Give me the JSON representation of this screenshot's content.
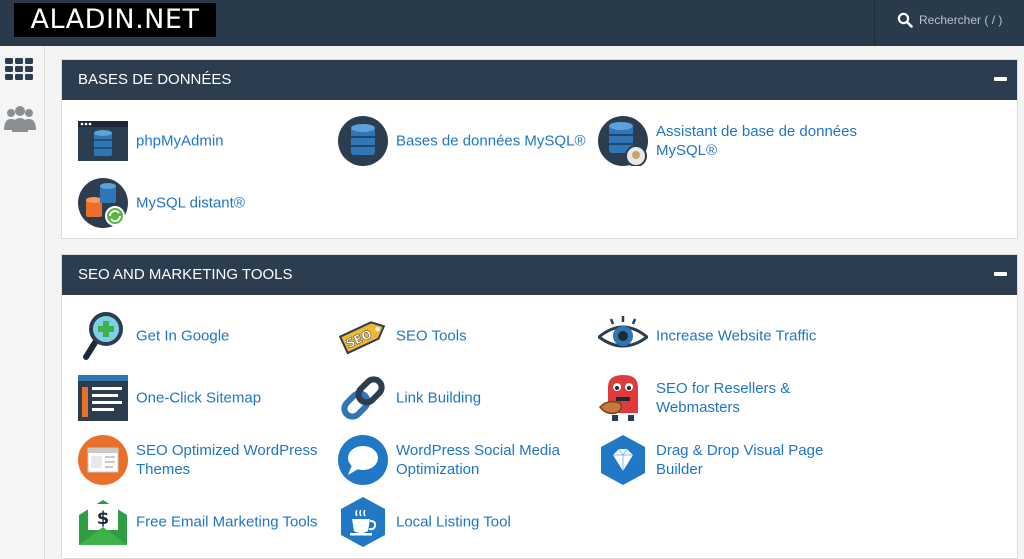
{
  "header": {
    "logo_text": "ALADIN.NET",
    "search_placeholder": "Rechercher ( / )"
  },
  "sidebar": {
    "items": [
      {
        "icon": "grid-icon"
      },
      {
        "icon": "users-icon"
      }
    ]
  },
  "sections": [
    {
      "title": "BASES DE DONNÉES",
      "collapse_symbol": "minus-icon",
      "items": [
        {
          "label": "phpMyAdmin",
          "icon": "phpmyadmin-icon"
        },
        {
          "label": "Bases de données MySQL®",
          "icon": "mysql-databases-icon"
        },
        {
          "label": "Assistant de base de données MySQL®",
          "icon": "mysql-wizard-icon"
        },
        {
          "label": "MySQL distant®",
          "icon": "remote-mysql-icon"
        }
      ]
    },
    {
      "title": "SEO AND MARKETING TOOLS",
      "collapse_symbol": "minus-icon",
      "items": [
        {
          "label": "Get In Google",
          "icon": "magnifier-plus-icon"
        },
        {
          "label": "SEO Tools",
          "icon": "seo-tag-icon"
        },
        {
          "label": "Increase Website Traffic",
          "icon": "eye-icon"
        },
        {
          "label": "One-Click Sitemap",
          "icon": "sitemap-icon"
        },
        {
          "label": "Link Building",
          "icon": "chain-link-icon"
        },
        {
          "label": "SEO for Resellers & Webmasters",
          "icon": "monster-mascot-icon"
        },
        {
          "label": "SEO Optimized WordPress Themes",
          "icon": "wordpress-theme-icon"
        },
        {
          "label": "WordPress Social Media Optimization",
          "icon": "chat-bubble-icon"
        },
        {
          "label": "Drag & Drop Visual Page Builder",
          "icon": "diamond-icon"
        },
        {
          "label": "Free Email Marketing Tools",
          "icon": "dollar-envelope-icon"
        },
        {
          "label": "Local Listing Tool",
          "icon": "coffee-cup-icon"
        }
      ]
    }
  ],
  "colors": {
    "topbar": "#293a4a",
    "panel_header": "#2b3d4f",
    "link": "#1f76c4",
    "background": "#f4f4f4"
  }
}
